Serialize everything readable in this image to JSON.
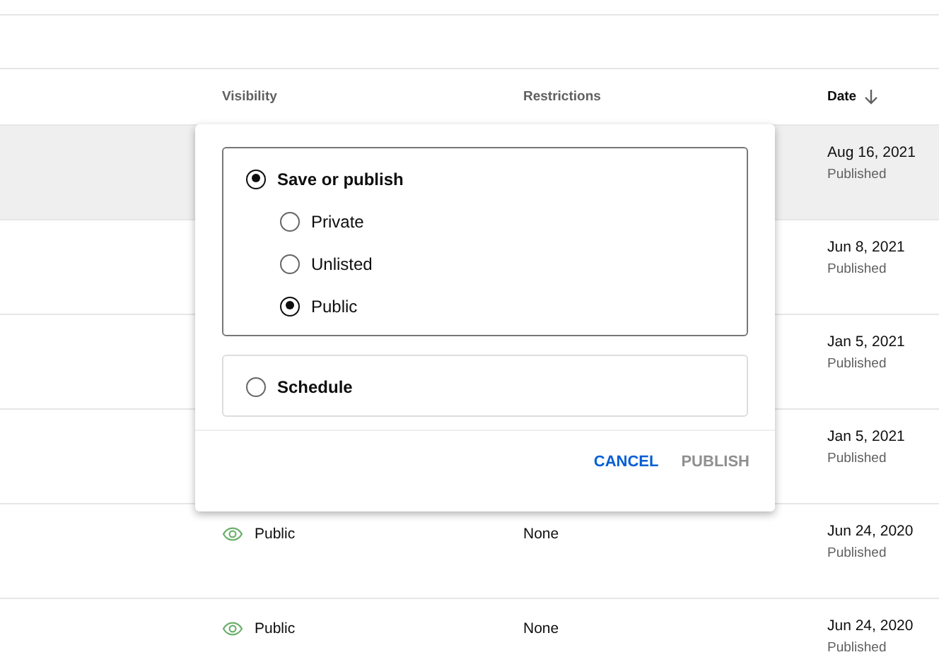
{
  "table": {
    "columns": [
      {
        "label": "Visibility",
        "sorted": false
      },
      {
        "label": "Restrictions",
        "sorted": false
      },
      {
        "label": "Date",
        "sorted": true
      }
    ],
    "rows": [
      {
        "selected": true,
        "date": "Aug 16, 2021",
        "status": "Published"
      },
      {
        "selected": false,
        "date": "Jun 8, 2021",
        "status": "Published"
      },
      {
        "selected": false,
        "date": "Jan 5, 2021",
        "status": "Published"
      },
      {
        "selected": false,
        "date": "Jan 5, 2021",
        "status": "Published"
      },
      {
        "selected": false,
        "visibility": "Public",
        "restrictions": "None",
        "date": "Jun 24, 2020",
        "status": "Published"
      },
      {
        "selected": false,
        "visibility": "Public",
        "restrictions": "None",
        "date": "Jun 24, 2020",
        "status": "Published"
      }
    ]
  },
  "dialog": {
    "groups": [
      {
        "label": "Save or publish",
        "selected": true,
        "options": [
          {
            "label": "Private",
            "selected": false
          },
          {
            "label": "Unlisted",
            "selected": false
          },
          {
            "label": "Public",
            "selected": true
          }
        ]
      },
      {
        "label": "Schedule",
        "selected": false
      }
    ],
    "buttons": [
      {
        "label": "CANCEL",
        "disabled": false
      },
      {
        "label": "PUBLISH",
        "disabled": true
      }
    ]
  }
}
